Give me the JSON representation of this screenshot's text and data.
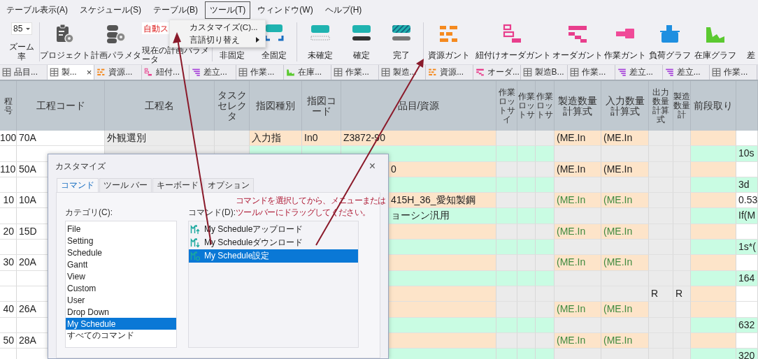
{
  "menu_bar": {
    "items": [
      {
        "label": "テーブル表示(A)",
        "selected": false
      },
      {
        "label": "スケジュール(S)",
        "selected": false
      },
      {
        "label": "テーブル(B)",
        "selected": false
      },
      {
        "label": "ツール(T)",
        "selected": true
      },
      {
        "label": "ウィンドウ(W)",
        "selected": false
      },
      {
        "label": "ヘルプ(H)",
        "selected": false
      }
    ]
  },
  "tool_menu": {
    "items": [
      {
        "label": "カスタマイズ(C)...",
        "submenu": false
      },
      {
        "label": "言語切り替え",
        "submenu": true
      }
    ]
  },
  "ribbon": {
    "groups": [
      {
        "items": [
          {
            "kind": "zoom",
            "value": "85",
            "label": "ズーム率"
          }
        ]
      },
      {
        "items": [
          {
            "kind": "button",
            "label": "プロジェクト"
          },
          {
            "kind": "button",
            "label": "計画パラメタ"
          },
          {
            "kind": "field",
            "value": "自動ス",
            "label": "現在の計画パラメータ"
          }
        ]
      },
      {
        "items": [
          {
            "kind": "button",
            "label": "非固定"
          },
          {
            "kind": "button",
            "label": "全固定"
          }
        ]
      },
      {
        "items": [
          {
            "kind": "button",
            "label": "未確定"
          },
          {
            "kind": "button",
            "label": "確定"
          },
          {
            "kind": "button",
            "label": "完了"
          }
        ]
      },
      {
        "items": [
          {
            "kind": "button",
            "label": "資源ガント"
          },
          {
            "kind": "button",
            "label": "紐付けオーダガント"
          },
          {
            "kind": "button",
            "label": "オーダガント"
          },
          {
            "kind": "button",
            "label": "作業ガント"
          },
          {
            "kind": "button",
            "label": "負荷グラフ"
          },
          {
            "kind": "button",
            "label": "在庫グラフ"
          },
          {
            "kind": "button",
            "label": "差"
          }
        ]
      }
    ]
  },
  "document_tabs": [
    {
      "label": "品目...",
      "selected": false
    },
    {
      "label": "製...",
      "selected": true,
      "close": "×"
    },
    {
      "label": "資源...",
      "selected": false
    },
    {
      "label": "紐付...",
      "selected": false
    },
    {
      "label": "差立...",
      "selected": false
    },
    {
      "label": "作業...",
      "selected": false
    },
    {
      "label": "在庫...",
      "selected": false
    },
    {
      "label": "作業...",
      "selected": false
    },
    {
      "label": "製造...",
      "selected": false
    },
    {
      "label": "資源...",
      "selected": false
    },
    {
      "label": "オーダ...",
      "selected": false
    },
    {
      "label": "製造B...",
      "selected": false
    },
    {
      "label": "作業...",
      "selected": false
    },
    {
      "label": "差立...",
      "selected": false
    },
    {
      "label": "差立...",
      "selected": false
    },
    {
      "label": "作業...",
      "selected": false
    }
  ],
  "table": {
    "columns": [
      "程号",
      "工程コード",
      "工程名",
      "タスクセレクタ",
      "指図種別",
      "指図コード",
      "品目/資源",
      "作業ロットサイ",
      "作業ロットサ",
      "作業ロットサ",
      "製造数量計算式",
      "入力数量計算式",
      "出力数量計算式",
      "製造数量計",
      "前段取り",
      null
    ],
    "rows": [
      {
        "kind": "input",
        "formulas_inherited": false,
        "cells": [
          "100",
          "70A",
          "外観選別",
          null,
          "入力指",
          "In0",
          "Z3872-90",
          null,
          null,
          null,
          "(ME.In",
          "(ME.In",
          null,
          null,
          null,
          null
        ]
      },
      {
        "kind": "use",
        "cells": [
          null,
          null,
          null,
          null,
          null,
          null,
          null,
          null,
          null,
          null,
          null,
          null,
          null,
          null,
          null,
          "10s"
        ]
      },
      {
        "kind": "input",
        "formulas_inherited": false,
        "cells": [
          "110",
          "50A",
          null,
          null,
          null,
          null,
          "0",
          null,
          null,
          null,
          "(ME.In",
          "(ME.In",
          null,
          null,
          null,
          null
        ]
      },
      {
        "kind": "use",
        "cells": [
          null,
          null,
          null,
          null,
          null,
          null,
          null,
          null,
          null,
          null,
          null,
          null,
          null,
          null,
          null,
          "3d"
        ]
      },
      {
        "kind": "input",
        "formulas_inherited": true,
        "cells": [
          "10",
          "10A",
          null,
          null,
          null,
          null,
          "415H_36_愛知製鋼",
          null,
          null,
          null,
          "(ME.In",
          "(ME.In",
          null,
          null,
          null,
          "0.53"
        ]
      },
      {
        "kind": "use",
        "cells": [
          null,
          null,
          null,
          null,
          null,
          null,
          "ョーシン汎用",
          null,
          null,
          null,
          null,
          null,
          null,
          null,
          null,
          "If(M"
        ]
      },
      {
        "kind": "input",
        "formulas_inherited": true,
        "cells": [
          "20",
          "15D",
          null,
          null,
          null,
          null,
          null,
          null,
          null,
          null,
          "(ME.In",
          "(ME.In",
          null,
          null,
          null,
          null
        ]
      },
      {
        "kind": "use",
        "cells": [
          null,
          null,
          null,
          null,
          null,
          null,
          null,
          null,
          null,
          null,
          null,
          null,
          null,
          null,
          null,
          "1s*("
        ]
      },
      {
        "kind": "input",
        "formulas_inherited": true,
        "cells": [
          "30",
          "20A",
          null,
          null,
          null,
          null,
          null,
          null,
          null,
          null,
          "(ME.In",
          "(ME.In",
          null,
          null,
          null,
          null
        ]
      },
      {
        "kind": "use",
        "cells": [
          null,
          null,
          null,
          null,
          null,
          null,
          null,
          null,
          null,
          null,
          null,
          null,
          null,
          null,
          null,
          "164"
        ]
      },
      {
        "kind": "input",
        "cells": [
          null,
          null,
          null,
          null,
          null,
          null,
          null,
          null,
          null,
          null,
          null,
          null,
          "R",
          "R",
          null,
          null
        ]
      },
      {
        "kind": "input",
        "formulas_inherited": true,
        "cells": [
          "40",
          "26A",
          null,
          null,
          null,
          null,
          null,
          null,
          null,
          null,
          "(ME.In",
          "(ME.In",
          null,
          null,
          null,
          null
        ]
      },
      {
        "kind": "use",
        "cells": [
          null,
          null,
          null,
          null,
          null,
          null,
          null,
          null,
          null,
          null,
          null,
          null,
          null,
          null,
          null,
          "632"
        ]
      },
      {
        "kind": "input",
        "formulas_inherited": true,
        "cells": [
          "50",
          "28A",
          null,
          null,
          null,
          null,
          null,
          null,
          null,
          null,
          "(ME.In",
          "(ME.In",
          null,
          null,
          null,
          null
        ]
      },
      {
        "kind": "use",
        "cells": [
          null,
          null,
          null,
          null,
          null,
          null,
          null,
          null,
          null,
          null,
          null,
          null,
          null,
          null,
          null,
          "320"
        ]
      }
    ]
  },
  "customize_dialog": {
    "title": "カスタマイズ",
    "close": "×",
    "tabs": [
      {
        "label": "コマンド",
        "selected": true
      },
      {
        "label": "ツール バー",
        "selected": false
      },
      {
        "label": "キーボード",
        "selected": false
      },
      {
        "label": "オプション",
        "selected": false
      }
    ],
    "hint": "コマンドを選択してから、メニューまたはツールバーにドラッグしてください。",
    "category_label": "カテゴリ(C):",
    "categories": [
      {
        "label": "File",
        "selected": false
      },
      {
        "label": "Setting",
        "selected": false
      },
      {
        "label": "Schedule",
        "selected": false
      },
      {
        "label": "Gantt",
        "selected": false
      },
      {
        "label": "View",
        "selected": false
      },
      {
        "label": "Custom",
        "selected": false
      },
      {
        "label": "User",
        "selected": false
      },
      {
        "label": "Drop Down",
        "selected": false
      },
      {
        "label": "My Schedule",
        "selected": true
      },
      {
        "label": "すべてのコマンド",
        "selected": false
      }
    ],
    "command_label": "コマンド(D):",
    "commands": [
      {
        "label": "My Scheduleアップロード",
        "selected": false
      },
      {
        "label": "My Scheduleダウンロード",
        "selected": false
      },
      {
        "label": "My Schedule設定",
        "selected": true
      }
    ]
  }
}
